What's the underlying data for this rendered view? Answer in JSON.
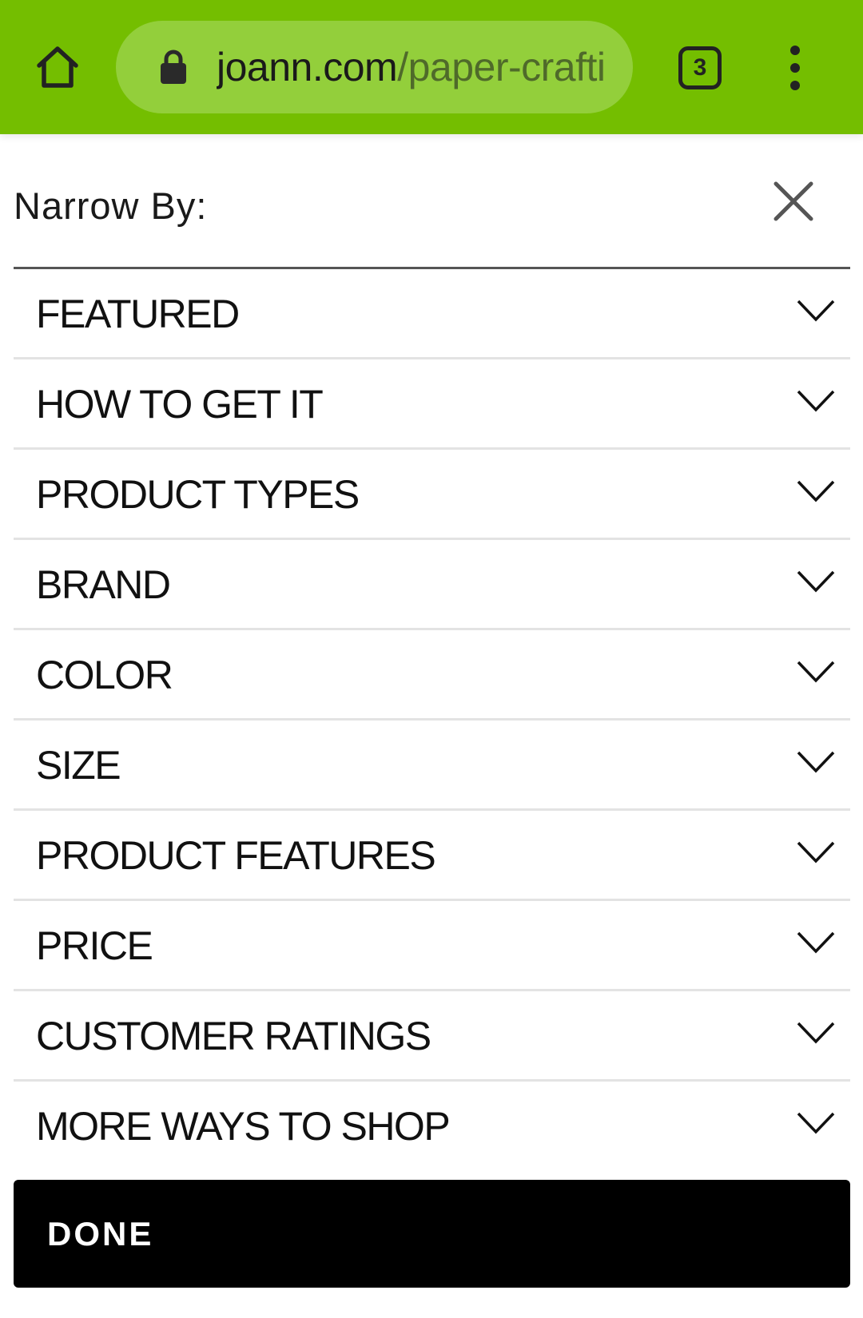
{
  "browser": {
    "url_domain": "joann.com",
    "url_path": "/paper-crafti",
    "tab_count": "3",
    "colors": {
      "toolbar": "#74be00",
      "url_pill": "#93cf3b"
    }
  },
  "panel": {
    "title": "Narrow By:",
    "filters": [
      {
        "label": "FEATURED"
      },
      {
        "label": "HOW TO GET IT"
      },
      {
        "label": "PRODUCT TYPES"
      },
      {
        "label": "BRAND"
      },
      {
        "label": "COLOR"
      },
      {
        "label": "SIZE"
      },
      {
        "label": "PRODUCT FEATURES"
      },
      {
        "label": "PRICE"
      },
      {
        "label": "CUSTOMER RATINGS"
      },
      {
        "label": "MORE WAYS TO SHOP"
      }
    ],
    "done_label": "DONE"
  }
}
